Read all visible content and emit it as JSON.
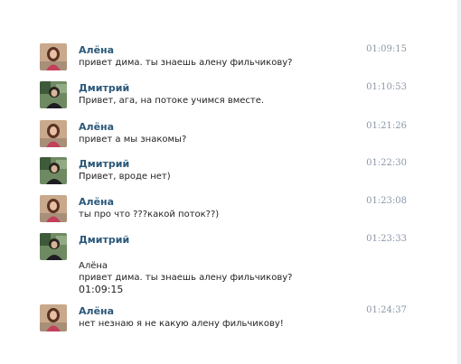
{
  "messages": [
    {
      "author": "Алёна",
      "avatar": "alena-avatar",
      "time": "01:09:15",
      "text": "привет дима. ты знаешь алену фильчикову?"
    },
    {
      "author": "Дмитрий",
      "avatar": "dmitry-avatar",
      "time": "01:10:53",
      "text": "Привет, ага, на потоке учимся вместе."
    },
    {
      "author": "Алёна",
      "avatar": "alena-avatar",
      "time": "01:21:26",
      "text": "привет а мы знакомы?"
    },
    {
      "author": "Дмитрий",
      "avatar": "dmitry-avatar",
      "time": "01:22:30",
      "text": "Привет, вроде нет)"
    },
    {
      "author": "Алёна",
      "avatar": "alena-avatar",
      "time": "01:23:08",
      "text": "ты про что ???какой поток??)"
    },
    {
      "author": "Дмитрий",
      "avatar": "dmitry-avatar",
      "time": "01:23:33",
      "text": "",
      "quote": {
        "author": "Алёна",
        "text": "привет дима. ты знаешь алену фильчикову?",
        "time": "01:09:15"
      }
    },
    {
      "author": "Алёна",
      "avatar": "alena-avatar",
      "time": "01:24:37",
      "text": "нет незнаю я не какую алену фильчикову!"
    }
  ],
  "colors": {
    "author_name": "#2b587a",
    "timestamp": "#8a97a6",
    "message_text": "#222222"
  }
}
